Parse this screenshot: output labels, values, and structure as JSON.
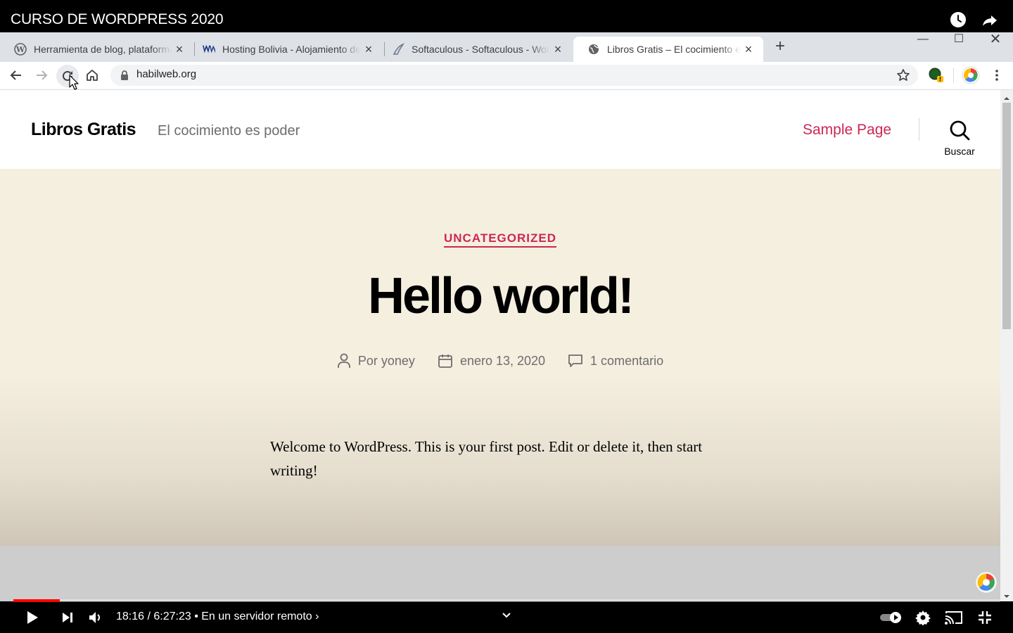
{
  "video": {
    "title": "CURSO DE WORDPRESS 2020",
    "time": "18:16 / 6:27:23 • En un servidor remoto ›",
    "progress": 0.047
  },
  "browser": {
    "tabs": [
      {
        "label": "Herramienta de blog, plataforma",
        "icon": "wordpress-icon"
      },
      {
        "label": "Hosting Bolivia - Alojamiento de",
        "icon": "hosting-icon"
      },
      {
        "label": "Softaculous - Softaculous - Word",
        "icon": "softaculous-icon"
      },
      {
        "label": "Libros Gratis – El cocimiento es p",
        "icon": "globe-icon",
        "active": true
      }
    ],
    "url": "habilweb.org"
  },
  "site": {
    "title": "Libros Gratis",
    "description": "El cocimiento es poder",
    "nav": [
      "Sample Page"
    ],
    "search_label": "Buscar"
  },
  "post": {
    "category": "UNCATEGORIZED",
    "title": "Hello world!",
    "author": "Por yoney",
    "date": "enero 13, 2020",
    "comments": "1 comentario",
    "body": "Welcome to WordPress. This is your first post. Edit or delete it, then start writing!"
  },
  "colors": {
    "accent": "#cd2653",
    "hero_bg": "#f5efe0",
    "tab_strip": "#dee1e6"
  }
}
